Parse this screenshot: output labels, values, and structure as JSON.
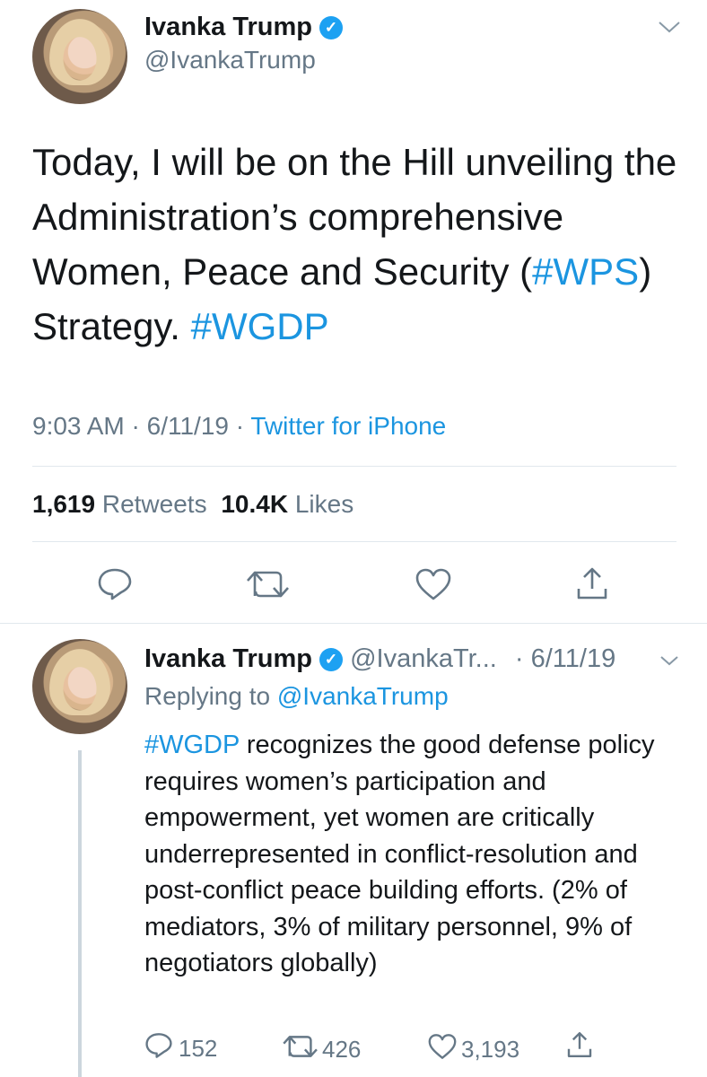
{
  "tweet": {
    "display_name": "Ivanka Trump",
    "handle": "@IvankaTrump",
    "text_parts": [
      "Today, I will be on the Hill unveiling the Administration’s comprehensive Women, Peace and Security (",
      "#WPS",
      ") Strategy.  ",
      "#WGDP"
    ],
    "time": "9:03 AM",
    "sep1": "·",
    "date": "6/11/19",
    "sep2": "·",
    "source": "Twitter for iPhone",
    "retweets_count": "1,619",
    "retweets_label": "Retweets",
    "likes_count": "10.4K",
    "likes_label": "Likes"
  },
  "reply": {
    "display_name": "Ivanka Trump",
    "handle": "@IvankaTr...",
    "date": "· 6/11/19",
    "replying_label": "Replying to",
    "replying_handle": "@IvankaTrump",
    "hashtag": "#WGDP",
    "text": " recognizes the good defense policy requires women’s participation and empowerment, yet women are critically underrepresented in conflict-resolution and post-conflict peace building efforts. (2% of mediators, 3% of military personnel, 9% of negotiators globally)",
    "reply_count": "152",
    "retweet_count": "426",
    "like_count": "3,193"
  },
  "colors": {
    "link": "#1b95e0",
    "secondary": "#657786",
    "verified": "#1da1f2",
    "divider": "#e1e8ed"
  },
  "icons": [
    "chevron-down-icon",
    "verified-icon",
    "reply-icon",
    "retweet-icon",
    "like-icon",
    "share-icon"
  ]
}
